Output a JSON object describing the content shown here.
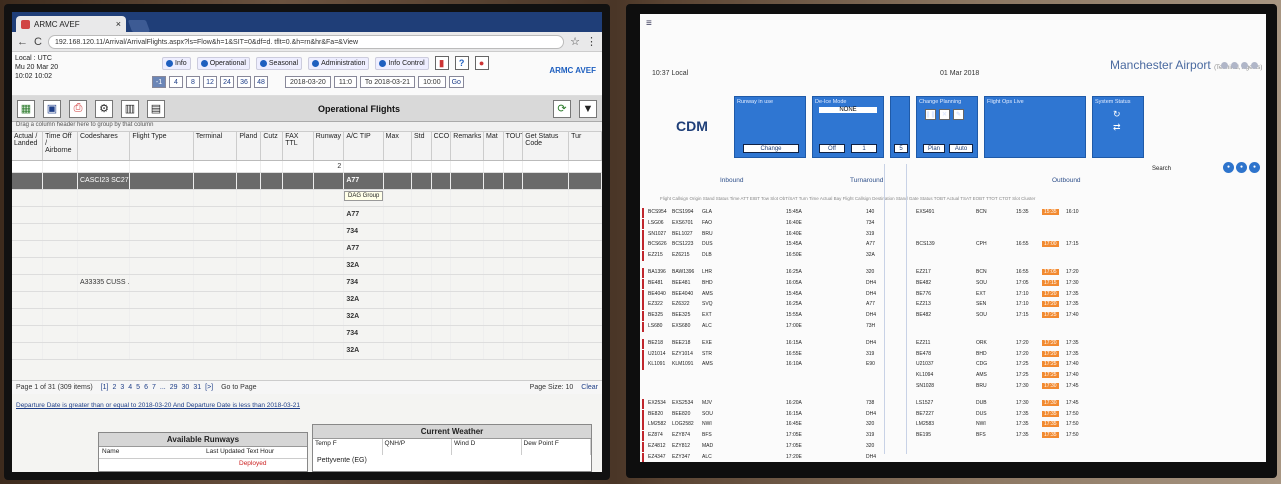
{
  "left_screen": {
    "tab_title": "ARMC AVEF",
    "url": "192.168.120.11/Arrival/ArrivalFlights.aspx?ls=Flow&h=1&SIT=0&df=d. tflt=0.&h=rn&hr&Fa=&View",
    "location": [
      "Local : UTC",
      "Mu 20 Mar 20",
      "10:02 10:02"
    ],
    "menu": [
      "Info",
      "Operational",
      "Seasonal",
      "Administration",
      "Info Control"
    ],
    "app_name": "ARMC AVEF",
    "hours": [
      "-1",
      "4",
      "8",
      "12",
      "24",
      "36",
      "48"
    ],
    "date_from": "2018-03-20",
    "time_from": "11:0",
    "date_to": "To 2018-03-21",
    "time_to": "10:00",
    "go": "Go",
    "toolbar_title": "Operational Flights",
    "drag_hint": "Drag a column header here to group by that column",
    "columns": [
      "Actual / Landed",
      "Time Off / Airborne",
      "Codeshares",
      "Flight Type",
      "Terminal",
      "Pland",
      "Cutz",
      "FAX TTL",
      "Runway",
      "A/C TIP",
      "Max",
      "Std",
      "CCO",
      "Remarks",
      "Mat",
      "TOUT",
      "Get Status Code",
      "Tur"
    ],
    "filter_value": "2",
    "tooltip": "DAG Group",
    "rows": [
      {
        "codeshare": "CASCI23 SC27 ...",
        "actype": "A77",
        "group": true
      },
      {
        "codeshare": "",
        "actype": "A77",
        "group": false
      },
      {
        "codeshare": "",
        "actype": "A77",
        "group": false
      },
      {
        "codeshare": "",
        "actype": "734",
        "group": false
      },
      {
        "codeshare": "",
        "actype": "A77",
        "group": false
      },
      {
        "codeshare": "",
        "actype": "32A",
        "group": false
      },
      {
        "codeshare": "A33335 CUSS ...",
        "actype": "734",
        "group": false
      },
      {
        "codeshare": "",
        "actype": "32A",
        "group": false
      },
      {
        "codeshare": "",
        "actype": "32A",
        "group": false
      },
      {
        "codeshare": "",
        "actype": "734",
        "group": false
      },
      {
        "codeshare": "",
        "actype": "32A",
        "group": false
      }
    ],
    "pager": {
      "info": "Page 1 of 31 (309 items)",
      "pages": [
        "[1]",
        "2",
        "3",
        "4",
        "5",
        "6",
        "7",
        "...",
        "29",
        "30",
        "31",
        "[>]"
      ],
      "goto": "Go to Page",
      "size": "Page Size: 10",
      "clear": "Clear"
    },
    "footer_note": "Departure Date is greater than or equal to 2018-03-20 And Departure Date is less than 2018-03-21",
    "runways_title": "Available Runways",
    "runways_sub": "Last Updated Text Hour",
    "runways_name": "Name",
    "runways_red": "Deployed",
    "weather_title": "Current Weather",
    "weather_cols": [
      "Temp F",
      "QNH/P",
      "Wind D",
      "Dew Point F"
    ],
    "weather_value": "Pettyvente (EG)"
  },
  "right_screen": {
    "local_time": "10:37 Local",
    "date": "01 Mar 2018",
    "airport": "Manchester Airport",
    "airport_sub": "(Terminal, Agents)",
    "cdm": "CDM",
    "panels": [
      {
        "title": "Runway in use",
        "button": "Change"
      },
      {
        "title": "De-Ice Mode",
        "value": "NONE",
        "buttons": [
          "Off",
          "1"
        ]
      },
      {
        "title": "",
        "buttons": [
          "5"
        ]
      },
      {
        "title": "Change Planning",
        "buttons": [
          "Plan",
          "Auto"
        ]
      },
      {
        "title": "Flight Ops Live",
        "buttons": []
      },
      {
        "title": "System Status",
        "buttons": []
      }
    ],
    "search": "Search",
    "sections": [
      "Inbound",
      "Turnaround",
      "Outbound"
    ],
    "col_header": "Flight   Callsign   Origin   Stand   Status   Time   ATT   EIBT   Tow   Slot   ObT/SAT   Turn Time   Actual   Bay   Flight   Callsign   Destination   Stand   Gate   Status   TOBT   Actual   TSAT   EOBT   TTOT   CTOT   Slot   Cluster",
    "rows": [
      {
        "in": "BCS954",
        "cs": "BCS1994",
        "org": "GLA",
        "t": "15:45A",
        "turn": "140",
        "out": "EXS491",
        "dest": "BCN",
        "tobt": "15:35",
        "hl": "15:35",
        "ct": "16:10"
      },
      {
        "in": "LSG06",
        "cs": "EXS6701",
        "org": "FAO",
        "t": "16:40E",
        "turn": "734",
        "out": "",
        "dest": "",
        "tobt": "",
        "hl": "",
        "ct": ""
      },
      {
        "in": "SN1027",
        "cs": "BEL1027",
        "org": "BRU",
        "t": "16:40E",
        "turn": "319",
        "out": "",
        "dest": "",
        "tobt": "",
        "hl": "",
        "ct": ""
      },
      {
        "in": "BCS626",
        "cs": "BCS1223",
        "org": "DUS",
        "t": "15:45A",
        "turn": "A77",
        "out": "BCS139",
        "dest": "CPH",
        "tobt": "16:55",
        "hl": "17:00",
        "ct": "17:15"
      },
      {
        "in": "EZ215",
        "cs": "EZ6215",
        "org": "DLB",
        "t": "16:50E",
        "turn": "32A",
        "out": "",
        "dest": "",
        "tobt": "",
        "hl": "",
        "ct": ""
      },
      {
        "in": "BA1396",
        "cs": "BAW1396",
        "org": "LHR",
        "t": "16:25A",
        "turn": "320",
        "out": "EZ217",
        "dest": "BCN",
        "tobt": "16:55",
        "hl": "17:05",
        "ct": "17:20"
      },
      {
        "in": "BE481",
        "cs": "BEE481",
        "org": "BHD",
        "t": "16:05A",
        "turn": "DH4",
        "out": "BE482",
        "dest": "SOU",
        "tobt": "17:05",
        "hl": "17:15",
        "ct": "17:30"
      },
      {
        "in": "BE4040",
        "cs": "BEE4040",
        "org": "AMS",
        "t": "15:45A",
        "turn": "DH4",
        "out": "BE776",
        "dest": "EXT",
        "tobt": "17:10",
        "hl": "17:20",
        "ct": "17:35"
      },
      {
        "in": "EZ322",
        "cs": "EZ6322",
        "org": "SVQ",
        "t": "16:25A",
        "turn": "A77",
        "out": "EZ213",
        "dest": "SEN",
        "tobt": "17:10",
        "hl": "17:20",
        "ct": "17:35"
      },
      {
        "in": "BE325",
        "cs": "BEE325",
        "org": "EXT",
        "t": "15:55A",
        "turn": "DH4",
        "out": "BE482",
        "dest": "SOU",
        "tobt": "17:15",
        "hl": "17:25",
        "ct": "17:40"
      },
      {
        "in": "LS680",
        "cs": "EXS680",
        "org": "ALC",
        "t": "17:00E",
        "turn": "73H",
        "out": "",
        "dest": "",
        "tobt": "",
        "hl": "",
        "ct": ""
      },
      {
        "in": "BE218",
        "cs": "BEE218",
        "org": "EXE",
        "t": "16:15A",
        "turn": "DH4",
        "out": "EZ211",
        "dest": "ORK",
        "tobt": "17:20",
        "hl": "17:20",
        "ct": "17:35"
      },
      {
        "in": "U21014",
        "cs": "EZY1014",
        "org": "STR",
        "t": "16:55E",
        "turn": "319",
        "out": "BE478",
        "dest": "BHD",
        "tobt": "17:20",
        "hl": "17:20",
        "ct": "17:35"
      },
      {
        "in": "KL1091",
        "cs": "KLM1091",
        "org": "AMS",
        "t": "16:10A",
        "turn": "E90",
        "out": "U21037",
        "dest": "CDG",
        "tobt": "17:25",
        "hl": "17:25",
        "ct": "17:40"
      },
      {
        "in": "",
        "cs": "",
        "org": "",
        "t": "",
        "turn": "",
        "out": "KL1094",
        "dest": "AMS",
        "tobt": "17:25",
        "hl": "17:25",
        "ct": "17:40"
      },
      {
        "in": "",
        "cs": "",
        "org": "",
        "t": "",
        "turn": "",
        "out": "SN1028",
        "dest": "BRU",
        "tobt": "17:30",
        "hl": "17:30",
        "ct": "17:45"
      },
      {
        "in": "EX2534",
        "cs": "EXS2534",
        "org": "MJV",
        "t": "16:20A",
        "turn": "738",
        "out": "LS1527",
        "dest": "DUB",
        "tobt": "17:30",
        "hl": "17:30",
        "ct": "17:45"
      },
      {
        "in": "BE820",
        "cs": "BEE820",
        "org": "SOU",
        "t": "16:15A",
        "turn": "DH4",
        "out": "BE7227",
        "dest": "DUS",
        "tobt": "17:35",
        "hl": "17:35",
        "ct": "17:50"
      },
      {
        "in": "LM2582",
        "cs": "LOG2582",
        "org": "NWI",
        "t": "16:45E",
        "turn": "320",
        "out": "LM2583",
        "dest": "NWI",
        "tobt": "17:35",
        "hl": "17:35",
        "ct": "17:50"
      },
      {
        "in": "EZ874",
        "cs": "EZY874",
        "org": "BFS",
        "t": "17:05E",
        "turn": "319",
        "out": "BE195",
        "dest": "BFS",
        "tobt": "17:35",
        "hl": "17:35",
        "ct": "17:50"
      },
      {
        "in": "EZ4812",
        "cs": "EZY812",
        "org": "MAD",
        "t": "17:05E",
        "turn": "320",
        "out": "",
        "dest": "",
        "tobt": "",
        "hl": "",
        "ct": ""
      },
      {
        "in": "EZ4347",
        "cs": "EZY347",
        "org": "ALC",
        "t": "17:20E",
        "turn": "DH4",
        "out": "",
        "dest": "",
        "tobt": "",
        "hl": "",
        "ct": ""
      },
      {
        "in": "BE1252",
        "cs": "BEE1252",
        "org": "BHD",
        "t": "16:30A",
        "turn": "320",
        "out": "BE1253",
        "dest": "BHD",
        "tobt": "17:50",
        "hl": "17:50",
        "ct": "18:05"
      },
      {
        "in": "SI447",
        "cs": "EXS447",
        "org": "BRS",
        "t": "17:35E",
        "turn": "DH4",
        "out": "BE7297",
        "dest": "DUS",
        "tobt": "17:50",
        "hl": "17:50",
        "ct": "18:05"
      }
    ]
  }
}
